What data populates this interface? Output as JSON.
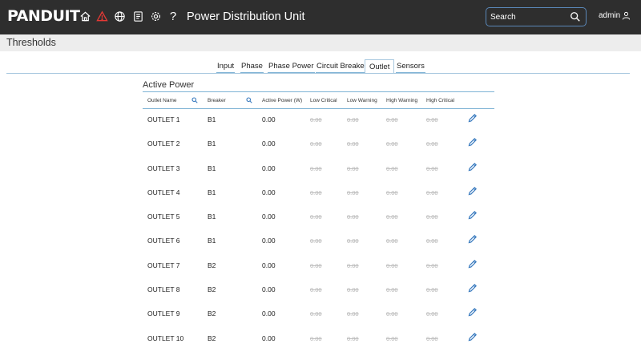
{
  "header": {
    "logo": "PANDUIT",
    "app_title": "Power Distribution Unit",
    "icons": [
      "home-icon",
      "alarm-icon",
      "globe-icon",
      "log-icon",
      "settings-icon",
      "help-icon"
    ],
    "help_glyph": "?",
    "search_placeholder": "Search",
    "user": "admin"
  },
  "page": {
    "title": "Thresholds"
  },
  "tabs": [
    {
      "label": "Input",
      "active": false
    },
    {
      "label": "Phase",
      "active": false
    },
    {
      "label": "Phase Power",
      "active": false
    },
    {
      "label": "Circuit Breaker",
      "active": false
    },
    {
      "label": "Outlet",
      "active": true
    },
    {
      "label": "Sensors",
      "active": false
    }
  ],
  "section": {
    "title": "Active Power"
  },
  "table": {
    "columns": [
      "Outlet Name",
      "Breaker",
      "Active Power (W)",
      "Low Critical",
      "Low Warning",
      "High Warning",
      "High Critical"
    ],
    "rows": [
      {
        "name": "OUTLET 1",
        "breaker": "B1",
        "power": "0.00",
        "low_critical": "0.00",
        "low_warning": "0.00",
        "high_warning": "0.00",
        "high_critical": "0.00"
      },
      {
        "name": "OUTLET 2",
        "breaker": "B1",
        "power": "0.00",
        "low_critical": "0.00",
        "low_warning": "0.00",
        "high_warning": "0.00",
        "high_critical": "0.00"
      },
      {
        "name": "OUTLET 3",
        "breaker": "B1",
        "power": "0.00",
        "low_critical": "0.00",
        "low_warning": "0.00",
        "high_warning": "0.00",
        "high_critical": "0.00"
      },
      {
        "name": "OUTLET 4",
        "breaker": "B1",
        "power": "0.00",
        "low_critical": "0.00",
        "low_warning": "0.00",
        "high_warning": "0.00",
        "high_critical": "0.00"
      },
      {
        "name": "OUTLET 5",
        "breaker": "B1",
        "power": "0.00",
        "low_critical": "0.00",
        "low_warning": "0.00",
        "high_warning": "0.00",
        "high_critical": "0.00"
      },
      {
        "name": "OUTLET 6",
        "breaker": "B1",
        "power": "0.00",
        "low_critical": "0.00",
        "low_warning": "0.00",
        "high_warning": "0.00",
        "high_critical": "0.00"
      },
      {
        "name": "OUTLET 7",
        "breaker": "B2",
        "power": "0.00",
        "low_critical": "0.00",
        "low_warning": "0.00",
        "high_warning": "0.00",
        "high_critical": "0.00"
      },
      {
        "name": "OUTLET 8",
        "breaker": "B2",
        "power": "0.00",
        "low_critical": "0.00",
        "low_warning": "0.00",
        "high_warning": "0.00",
        "high_critical": "0.00"
      },
      {
        "name": "OUTLET 9",
        "breaker": "B2",
        "power": "0.00",
        "low_critical": "0.00",
        "low_warning": "0.00",
        "high_warning": "0.00",
        "high_critical": "0.00"
      },
      {
        "name": "OUTLET 10",
        "breaker": "B2",
        "power": "0.00",
        "low_critical": "0.00",
        "low_warning": "0.00",
        "high_warning": "0.00",
        "high_critical": "0.00"
      }
    ]
  },
  "colors": {
    "header_bg": "#2e2e2e",
    "accent": "#3a7bbf",
    "alarm": "#e53935",
    "divider": "#7fb3d5",
    "disabled_text": "#b9b9b9"
  }
}
